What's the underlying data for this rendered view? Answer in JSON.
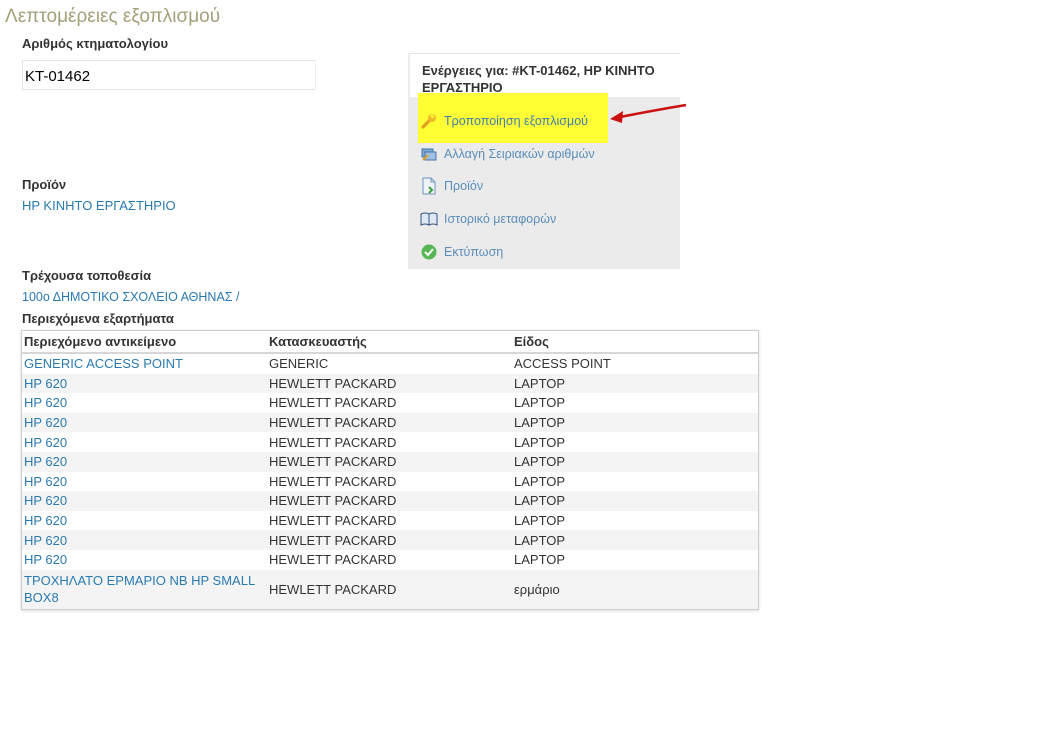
{
  "page": {
    "title": "Λεπτομέρειες εξοπλισμού"
  },
  "inventory": {
    "label": "Αριθμός κτηματολογίου",
    "value": "KT-01462"
  },
  "product": {
    "label": "Προϊόν",
    "link": "HP ΚΙΝΗΤΟ ΕΡΓΑΣΤΗΡΙΟ"
  },
  "location": {
    "label": "Τρέχουσα τοποθεσία",
    "link": "100ο ΔΗΜΟΤΙΚΟ ΣΧΟΛΕΙΟ ΑΘΗΝΑΣ /"
  },
  "actions": {
    "header": "Ενέργειες για: #KT-01462, HP ΚΙΝΗΤΟ ΕΡΓΑΣΤΗΡΙΟ",
    "items": [
      {
        "label": "Τροποποίηση εξοπλισμού",
        "icon": "wrench-icon"
      },
      {
        "label": "Αλλαγή Σειριακών αριθμών",
        "icon": "serial-numbers-icon"
      },
      {
        "label": "Προϊόν",
        "icon": "product-page-icon"
      },
      {
        "label": "Ιστορικό μεταφορών",
        "icon": "book-icon"
      },
      {
        "label": "Εκτύπωση",
        "icon": "check-circle-icon"
      }
    ]
  },
  "components": {
    "label": "Περιεχόμενα εξαρτήματα",
    "columns": [
      "Περιεχόμενο αντικείμενο",
      "Κατασκευαστής",
      "Είδος"
    ],
    "rows": [
      [
        "GENERIC ACCESS POINT",
        "GENERIC",
        "ACCESS POINT"
      ],
      [
        "HP 620",
        "HEWLETT PACKARD",
        "LAPTOP"
      ],
      [
        "HP 620",
        "HEWLETT PACKARD",
        "LAPTOP"
      ],
      [
        "HP 620",
        "HEWLETT PACKARD",
        "LAPTOP"
      ],
      [
        "HP 620",
        "HEWLETT PACKARD",
        "LAPTOP"
      ],
      [
        "HP 620",
        "HEWLETT PACKARD",
        "LAPTOP"
      ],
      [
        "HP 620",
        "HEWLETT PACKARD",
        "LAPTOP"
      ],
      [
        "HP 620",
        "HEWLETT PACKARD",
        "LAPTOP"
      ],
      [
        "HP 620",
        "HEWLETT PACKARD",
        "LAPTOP"
      ],
      [
        "HP 620",
        "HEWLETT PACKARD",
        "LAPTOP"
      ],
      [
        "HP 620",
        "HEWLETT PACKARD",
        "LAPTOP"
      ],
      [
        "ΤΡΟΧΗΛΑΤΟ ΕΡΜΑΡΙΟ NB HP SMALL BOX8",
        "HEWLETT PACKARD",
        "ερμάριο"
      ]
    ]
  },
  "colors": {
    "title": "#a4a07a",
    "link": "#2a7ab0",
    "highlight": "#ffff33",
    "arrow": "#cc1111"
  }
}
